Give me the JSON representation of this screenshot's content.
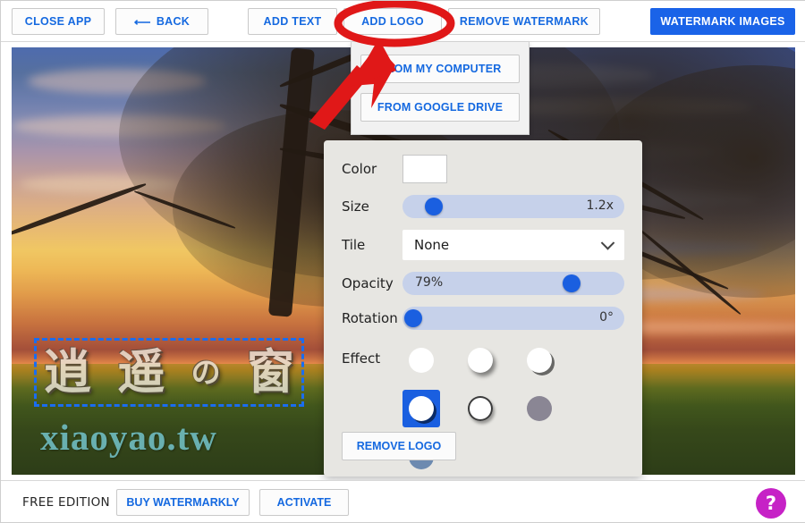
{
  "toolbar": {
    "close_app": "CLOSE APP",
    "back": "BACK",
    "back_arrow_icon": "arrow-left-icon",
    "add_text": "ADD TEXT",
    "add_logo": "ADD LOGO",
    "remove_watermark": "REMOVE WATERMARK",
    "watermark_images": "WATERMARK IMAGES",
    "primary_color": "#1a63e8",
    "link_color": "#1569e0"
  },
  "logo_dropdown": {
    "from_my_computer": "FROM MY COMPUTER",
    "from_google_drive": "FROM GOOGLE DRIVE"
  },
  "settings": {
    "color": {
      "label": "Color",
      "value": "#ffffff"
    },
    "size": {
      "label": "Size",
      "value": "1.2x",
      "knob_percent": 11
    },
    "tile": {
      "label": "Tile",
      "value": "None",
      "chevron_icon": "chevron-down-icon"
    },
    "opacity": {
      "label": "Opacity",
      "value": "79%",
      "knob_percent": 79
    },
    "rotation": {
      "label": "Rotation",
      "value": "0°",
      "knob_percent": 0
    },
    "effect": {
      "label": "Effect",
      "options": [
        {
          "name": "plain",
          "style": "plain",
          "selected": false
        },
        {
          "name": "soft-shadow",
          "style": "shadow-soft",
          "selected": false
        },
        {
          "name": "hard-shadow",
          "style": "shadow-hard",
          "selected": false
        },
        {
          "name": "inner-shadow",
          "style": "shadow-hard",
          "selected": true
        },
        {
          "name": "dark-outline",
          "style": "outline-dark",
          "selected": false
        },
        {
          "name": "grey-fill",
          "style": "grey-fill",
          "selected": false
        },
        {
          "name": "blue-fill",
          "style": "blue-fill",
          "selected": false
        }
      ],
      "selected_color": "#1a5fe0"
    },
    "remove_logo": "REMOVE LOGO"
  },
  "canvas": {
    "watermark_chars": [
      "逍",
      "遥",
      "の",
      "窗"
    ],
    "site_text": "xiaoyao.tw",
    "site_text_color": "#69b0b0",
    "selection_color": "#1a6df0"
  },
  "bottombar": {
    "edition": "FREE EDITION",
    "buy": "BUY WATERMARKLY",
    "activate": "ACTIVATE",
    "help_icon": "question-mark-icon",
    "help_label": "?",
    "help_color": "#c622c6"
  },
  "annotation": {
    "highlight_color": "#e01818",
    "highlight_target": "ADD LOGO",
    "arrow_icon": "red-arrow-icon",
    "ellipse_icon": "red-ellipse-icon"
  }
}
